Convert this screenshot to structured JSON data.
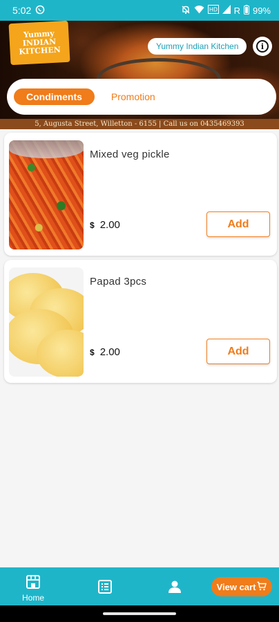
{
  "status_bar": {
    "time": "5:02",
    "network_label": "R",
    "battery": "99%",
    "background_color": "#1fb5c9"
  },
  "banner": {
    "logo_lines": [
      "Yummy",
      "INDIAN",
      "KITCHEN"
    ],
    "kitchen_name": "Yummy Indian Kitchen",
    "address": "5, Augusta Street, Willetton - 6155  |  Call us on 0435469393"
  },
  "tabs": [
    {
      "label": "Condiments",
      "active": true
    },
    {
      "label": "Promotion",
      "active": false
    }
  ],
  "products": [
    {
      "name": "Mixed veg pickle",
      "currency": "$",
      "price": "2.00",
      "add_label": "Add",
      "image": "mixed-veg-pickle"
    },
    {
      "name": "Papad 3pcs",
      "currency": "$",
      "price": "2.00",
      "add_label": "Add",
      "image": "papad"
    }
  ],
  "bottom_nav": {
    "home_label": "Home",
    "home_icon": "store-icon",
    "menu_icon": "menu-list-icon",
    "profile_icon": "person-icon",
    "view_cart_label": "View cart",
    "cart_icon": "shopping-cart-icon"
  },
  "colors": {
    "accent": "#f07c1a",
    "brand": "#1fb5c9"
  }
}
